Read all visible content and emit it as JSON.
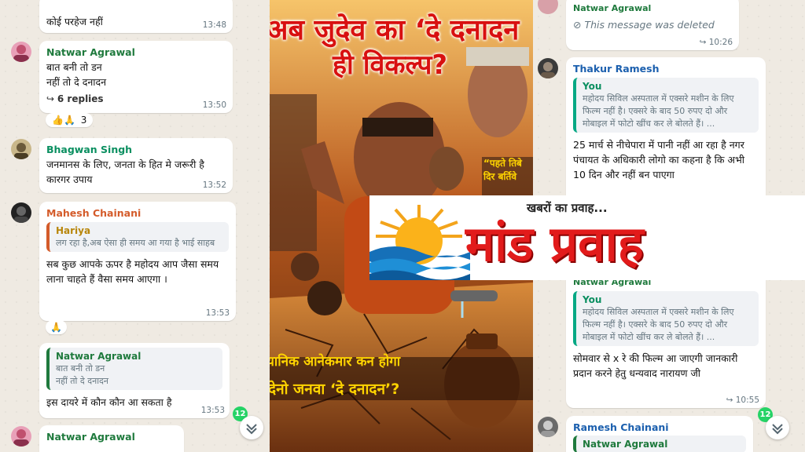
{
  "left_chat": {
    "messages": [
      {
        "text": "कोई परहेज नहीं",
        "time": "13:48"
      },
      {
        "sender": "Natwar Agrawal",
        "sender_color": "#1f7a3d",
        "text": "बात बनी तो डन\nनहीं तो दे दनादन",
        "replies": "6 replies",
        "time": "13:50",
        "reactions": "👍🙏",
        "reaction_count": "3"
      },
      {
        "sender": "Bhagwan Singh",
        "sender_color": "#0a8f60",
        "text": "जनमानस के लिए, जनता के हित मे जरूरी है कारगर उपाय",
        "time": "13:52"
      },
      {
        "sender": "Mahesh Chainani",
        "sender_color": "#d45b2a",
        "quote_name": "Hariya",
        "quote_text": "लग रहा है,अब ऐसा ही समय आ गया है भाई साहब",
        "text": "सब कुछ आपके ऊपर है महोदय आप जैसा समय लाना चाहते हैं वैसा समय आएगा ।",
        "time": "13:53",
        "reactions": "🙏"
      },
      {
        "quote_name": "Natwar Agrawal",
        "quote_text": "बात बनी तो डन\nनहीं तो दे दनादन",
        "text": "इस दायरे में कौन कौन आ सकता है",
        "time": "13:53"
      },
      {
        "sender": "Natwar Agrawal",
        "sender_color": "#1f7a3d"
      }
    ],
    "unread_count": "12"
  },
  "poster": {
    "headline_1": "अब जुदेव का ‘दे दनादन",
    "headline_2": "ही विकल्प?",
    "side_caption": "“पहते तिबे\nदिर बर्तिवे",
    "bottom_1": "यानिक आनेकमार कन होगा",
    "bottom_2": "देनो जनवा ‘दे दनादन’?"
  },
  "right_chat": {
    "messages": [
      {
        "sender": "Natwar Agrawal",
        "deleted_text": "This message was deleted",
        "time": "10:26"
      },
      {
        "sender": "Thakur Ramesh",
        "sender_color": "#1b5fae",
        "quote_name": "You",
        "quote_text": "महोदय सिविल अस्पताल में एक्सरे मशीन के लिए फिल्म नहीं है। एक्सरे के बाद 50 रुपए  दो और मोबाइल में फोटो खींच कर ले बोलते हैं। ...",
        "text": "25 मार्च से नीचेपारा में पानी नहीं आ रहा है नगर पंचायत के अधिकारी लोगो का कहना है कि अभी 10 दिन और नहीं बन पाएगा"
      },
      {
        "sender": "Natwar Agrawal",
        "quote_name": "You",
        "quote_text": "महोदय सिविल अस्पताल में एक्सरे मशीन के लिए फिल्म नहीं है। एक्सरे के बाद 50 रुपए  दो और मोबाइल में फोटो खींच कर ले बोलते हैं। ...",
        "text": "सोमवार से x रे की फिल्म आ जाएगी जानकारी प्रदान करने हेतु धन्यवाद नारायण जी",
        "time": "10:55"
      },
      {
        "sender": "Ramesh Chainani",
        "sender_color": "#1b5fae",
        "quote_name": "Natwar Agrawal"
      }
    ],
    "unread_count": "12"
  },
  "banner": {
    "tagline": "खबरों का प्रवाह...",
    "title": "मांड प्रवाह",
    "title_color": "#e21b1b"
  },
  "icons": [
    "forward-icon",
    "blocked-icon",
    "chevron-down-icon",
    "reply-arrow-icon"
  ]
}
